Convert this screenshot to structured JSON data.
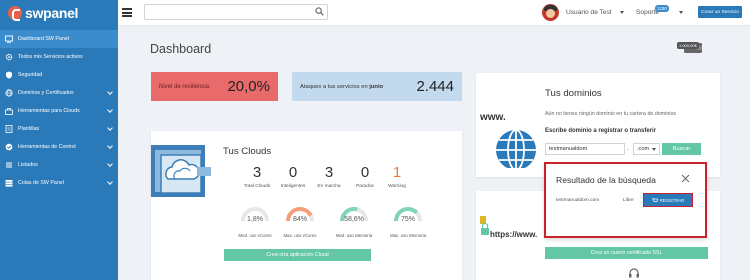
{
  "brand": {
    "name": "swpanel"
  },
  "sidebar": {
    "items": [
      {
        "label": "Dashboard SW Panel",
        "icon": "dashboard-icon",
        "active": true,
        "chevron": false
      },
      {
        "label": "Todos mis Servicios activos",
        "icon": "gear-icon",
        "active": false,
        "chevron": false
      },
      {
        "label": "Seguridad",
        "icon": "shield-icon",
        "active": false,
        "chevron": false
      },
      {
        "label": "Dominios y Certificados",
        "icon": "globe-icon",
        "active": false,
        "chevron": true
      },
      {
        "label": "Herramientas para Clouds",
        "icon": "wrench-icon",
        "active": false,
        "chevron": true
      },
      {
        "label": "Plantillas",
        "icon": "template-icon",
        "active": false,
        "chevron": true
      },
      {
        "label": "Herramientas de Control",
        "icon": "check-icon",
        "active": false,
        "chevron": true
      },
      {
        "label": "Listados",
        "icon": "list-icon",
        "active": false,
        "chevron": true
      },
      {
        "label": "Colas de SW Panel",
        "icon": "queue-icon",
        "active": false,
        "chevron": true
      }
    ]
  },
  "topbar": {
    "search_placeholder": "",
    "user_name": "Usuario de Test",
    "support_label": "Soporte",
    "support_badge": "1230",
    "create_service_label": "Crear un Servicio"
  },
  "page": {
    "title": "Dashboard",
    "balance_badge": "1.000,00€"
  },
  "stats": {
    "resilience_label": "Nivel de resiliencia",
    "resilience_value": "20,0%",
    "attacks_label_prefix": "Ataques a tus servicios en ",
    "attacks_month": "junio",
    "attacks_value": "2.444"
  },
  "clouds": {
    "title": "Tus Clouds",
    "metrics": [
      {
        "value": "3",
        "caption": "Total Clouds"
      },
      {
        "value": "0",
        "caption": "Inteligentes"
      },
      {
        "value": "3",
        "caption": "En marcha"
      },
      {
        "value": "0",
        "caption": "Parados"
      },
      {
        "value": "1",
        "caption": "Warning"
      }
    ],
    "gauges": [
      {
        "value": "1,8%",
        "fraction": 0.018,
        "caption": "Med. uso vCores",
        "color": "#d9d9d9"
      },
      {
        "value": "84%",
        "fraction": 0.84,
        "caption": "Max. uso vCores",
        "color": "#f4a07a"
      },
      {
        "value": "58,6%",
        "fraction": 0.586,
        "caption": "Med. uso Memoria",
        "color": "#7ed6b5"
      },
      {
        "value": "75%",
        "fraction": 0.75,
        "caption": "Max. uso Memoria",
        "color": "#7ed6b5"
      }
    ],
    "button_label": "Crea otra aplicación Cloud"
  },
  "domains": {
    "title_prefix": "Tus ",
    "title_strong": "dominios",
    "empty_text": "Aún no tienes ningún dominio en tu cartera de dominios",
    "register_label": "Escribe dominio a registrar o transferir",
    "input_value": "testmanualdom",
    "dot": ".",
    "tld_value": ".com",
    "search_button": "Buscar",
    "image_text": "www."
  },
  "ssl": {
    "button_label": "Crea un nuevo certificado SSL",
    "image_text": "https://www."
  },
  "modal": {
    "title": "Resultado de la búsqueda",
    "domain": "testmanualdom.com",
    "status": "Libre",
    "register_button": "REGISTRAR"
  },
  "colors": {
    "accent": "#2a79b8",
    "green": "#63c6a4",
    "red": "#e96a6a",
    "light_blue": "#c2d9ee",
    "orange": "#ef7d2e",
    "highlight": "#c8232c"
  }
}
